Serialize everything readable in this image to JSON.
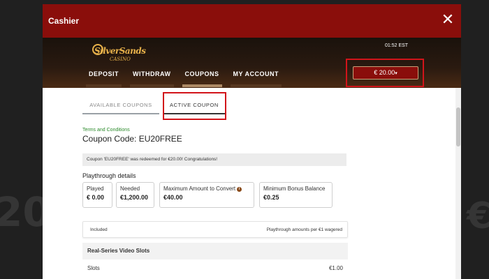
{
  "background": {
    "left_text": "20",
    "right_text": "€"
  },
  "modal": {
    "title": "Cashier"
  },
  "brand": {
    "logo_text": "SilverSands",
    "logo_sub": "CASINO"
  },
  "header": {
    "time": "01:52 EST",
    "balance": "€ 20.00",
    "caret": "▾"
  },
  "nav": {
    "items": [
      {
        "label": "DEPOSIT"
      },
      {
        "label": "WITHDRAW"
      },
      {
        "label": "COUPONS"
      },
      {
        "label": "MY ACCOUNT"
      }
    ],
    "active": "COUPONS"
  },
  "tabs": {
    "available": "AVAILABLE COUPONS",
    "active": "ACTIVE COUPON"
  },
  "coupon": {
    "terms_link": "Terms and Conditions",
    "code_line": "Coupon Code: EU20FREE",
    "message": "Coupon 'EU20FREE' was redeemed for €20.00! Congratulations!"
  },
  "playthrough": {
    "title": "Playthrough details",
    "stats": [
      {
        "label": "Played",
        "value": "€ 0.00"
      },
      {
        "label": "Needed",
        "value": "€1,200.00"
      },
      {
        "label": "Maximum Amount to Convert",
        "value": "€40.00"
      },
      {
        "label": "Minimum Bonus Balance",
        "value": "€0.25"
      }
    ]
  },
  "table": {
    "col_left": "Included",
    "col_right": "Playthrough amounts per €1 wagered",
    "category": "Real-Series Video Slots",
    "rows": [
      {
        "name": "Slots",
        "amount": "€1.00"
      }
    ]
  },
  "colors": {
    "brand_red": "#8a0e0b",
    "highlight_red": "#d2141a",
    "gold": "#e7b14a",
    "link_green": "#2a8a2a"
  }
}
